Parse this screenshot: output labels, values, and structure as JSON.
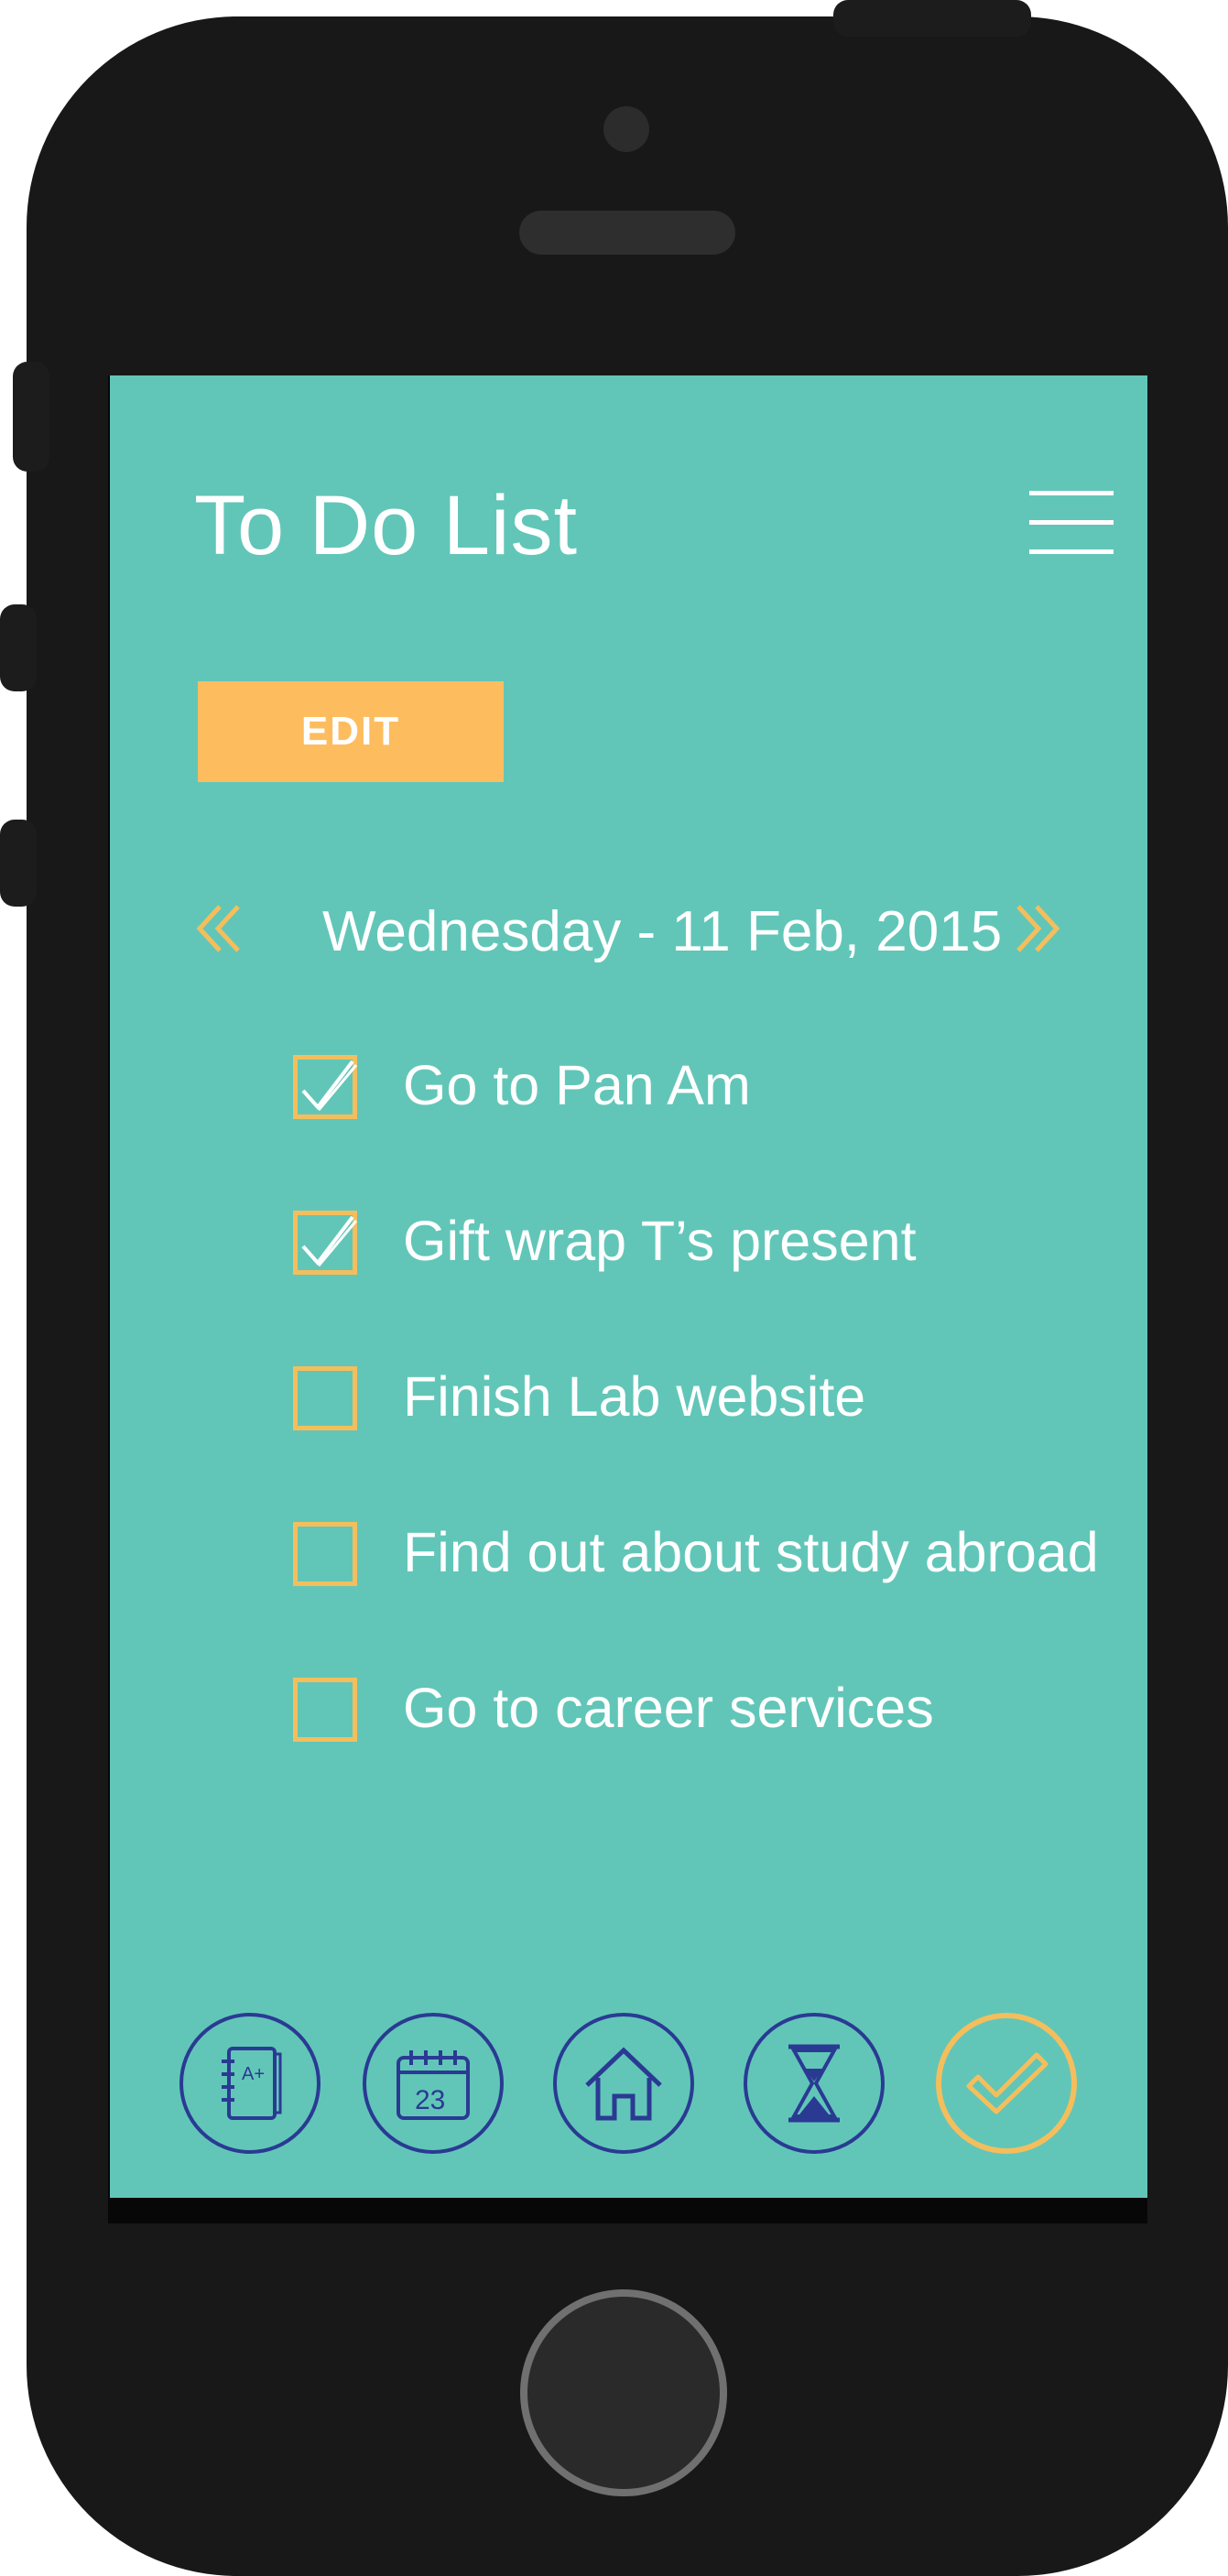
{
  "app": {
    "title": "To Do List",
    "edit_label": "EDIT",
    "date_label": "Wednesday - 11 Feb, 2015"
  },
  "icons": {
    "menu": "hamburger-menu-icon",
    "prev": "chevron-left-icon",
    "next": "chevron-right-icon"
  },
  "tasks": [
    {
      "label": "Go to Pan Am",
      "checked": true
    },
    {
      "label": "Gift wrap T’s present",
      "checked": true
    },
    {
      "label": "Finish Lab website",
      "checked": false
    },
    {
      "label": "Find out about study abroad",
      "checked": false
    },
    {
      "label": "Go to career services",
      "checked": false
    }
  ],
  "nav": {
    "items": [
      {
        "name": "grades-notebook",
        "text": "A+",
        "active": false
      },
      {
        "name": "calendar",
        "text": "23",
        "active": false
      },
      {
        "name": "home",
        "active": false
      },
      {
        "name": "hourglass",
        "active": false
      },
      {
        "name": "todo-checkmark",
        "active": true
      }
    ]
  },
  "colors": {
    "screen_bg": "#61c6b8",
    "accent_gold": "#fdbd5f",
    "icon_blue": "#2a3a93",
    "phone_body": "#181818",
    "text": "#ffffff"
  }
}
